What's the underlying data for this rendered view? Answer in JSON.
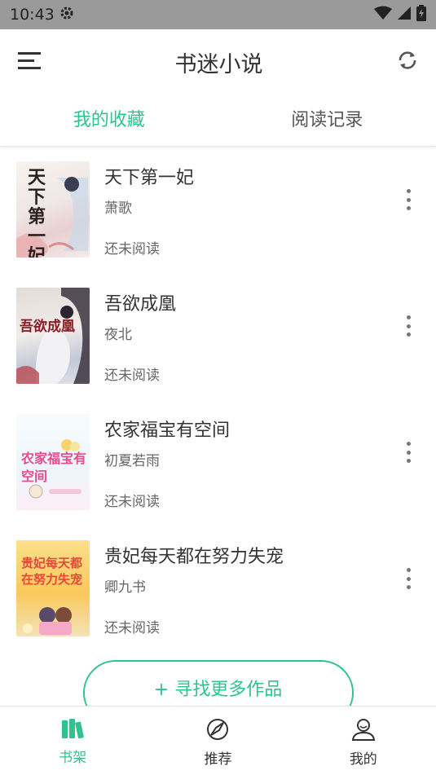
{
  "statusbar": {
    "time": "10:43"
  },
  "appbar": {
    "title": "书迷小说"
  },
  "tabs": [
    {
      "label": "我的收藏",
      "active": true
    },
    {
      "label": "阅读记录",
      "active": false
    }
  ],
  "books": [
    {
      "title": "天下第一妃",
      "author": "萧歌",
      "status": "还未阅读",
      "cover_text": "天下第一妃"
    },
    {
      "title": "吾欲成凰",
      "author": "夜北",
      "status": "还未阅读",
      "cover_text": "吾欲成凰"
    },
    {
      "title": "农家福宝有空间",
      "author": "初夏若雨",
      "status": "还未阅读",
      "cover_text": "农家福宝有空间"
    },
    {
      "title": "贵妃每天都在努力失宠",
      "author": "卿九书",
      "status": "还未阅读",
      "cover_text": "贵妃每天都在努力失宠"
    }
  ],
  "find_more": "+ 寻找更多作品",
  "bottom_nav": [
    {
      "label": "书架",
      "icon": "books-icon",
      "active": true
    },
    {
      "label": "推荐",
      "icon": "compass-icon",
      "active": false
    },
    {
      "label": "我的",
      "icon": "person-icon",
      "active": false
    }
  ],
  "colors": {
    "accent": "#2fc38d",
    "statusbar": "#9a9a9a"
  }
}
